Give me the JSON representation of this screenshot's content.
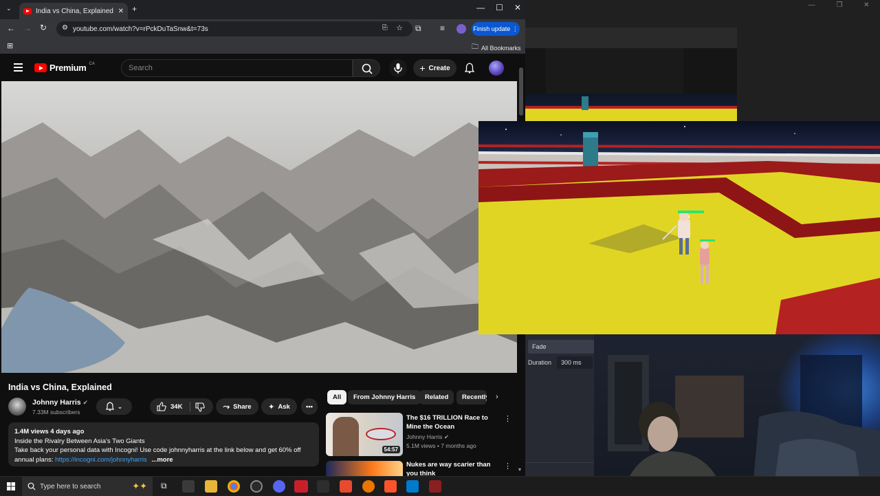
{
  "browser": {
    "tab_title": "India vs China, Explained - YouTube",
    "url": "youtube.com/watch?v=rPckDuTaSnw&t=73s",
    "finish_update": "Finish update",
    "all_bookmarks": "All Bookmarks"
  },
  "youtube": {
    "logo_text": "Premium",
    "region": "CA",
    "search_placeholder": "Search",
    "create_label": "Create",
    "video_title": "India vs China, Explained",
    "channel_name": "Johnny Harris",
    "subscribers": "7.33M subscribers",
    "likes": "34K",
    "share_label": "Share",
    "ask_label": "Ask",
    "description": {
      "meta": "1.4M views  4 days ago",
      "line1": "Inside the Rivalry Between Asia's Two Giants",
      "line2": "Take back your personal data with Incogni! Use code johnnyharris at the link below and get 60% off",
      "line3_prefix": "annual plans: ",
      "link": "https://incogni.com/johnnyharris",
      "more": "...more"
    },
    "chips": [
      "All",
      "From Johnny Harris",
      "Related",
      "Recently"
    ],
    "recommendations": [
      {
        "title": "The $16 TRILLION Race to Mine the Ocean",
        "channel": "Johnny Harris",
        "meta": "5.1M views • 7 months ago",
        "duration": "54:57"
      },
      {
        "title": "Nukes are way scarier than you think",
        "channel": "",
        "meta": "",
        "duration": ""
      }
    ]
  },
  "obs": {
    "transition": "Fade",
    "duration_label": "Duration",
    "duration_value": "300 ms"
  },
  "game": {
    "floor_color": "#e1d524",
    "border_color": "#9b1a1a"
  },
  "taskbar": {
    "search_placeholder": "Type here to search"
  },
  "colors": {
    "yt_red": "#ff0000",
    "link_blue": "#3ea6ff",
    "update_blue": "#0b57d0"
  }
}
